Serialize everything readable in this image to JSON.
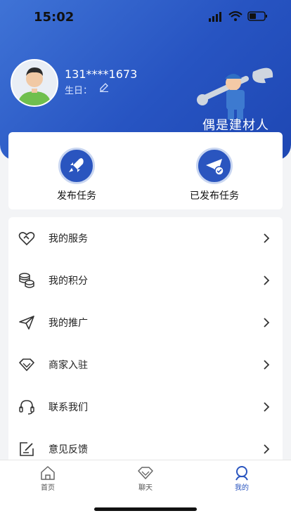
{
  "status_bar": {
    "time": "15:02"
  },
  "profile": {
    "phone": "131****1673",
    "birthday_label": "生日："
  },
  "banner": {
    "slogan": "偶是建材人"
  },
  "actions": [
    {
      "label": "发布任务",
      "icon": "rocket-icon"
    },
    {
      "label": "已发布任务",
      "icon": "paper-plane-check-icon"
    }
  ],
  "menu": [
    {
      "label": "我的服务",
      "icon": "heart-handshake-icon"
    },
    {
      "label": "我的积分",
      "icon": "coins-icon"
    },
    {
      "label": "我的推广",
      "icon": "paper-plane-icon"
    },
    {
      "label": "商家入驻",
      "icon": "diamond-icon"
    },
    {
      "label": "联系我们",
      "icon": "headset-icon"
    },
    {
      "label": "意见反馈",
      "icon": "feedback-edit-icon"
    }
  ],
  "tabbar": [
    {
      "label": "首页",
      "icon": "home-icon",
      "active": false
    },
    {
      "label": "聊天",
      "icon": "chat-diamond-icon",
      "active": false
    },
    {
      "label": "我的",
      "icon": "user-icon",
      "active": true
    }
  ],
  "colors": {
    "primary": "#2a55bf",
    "header_top": "#3f73d6",
    "page_bg": "#f3f4f6"
  }
}
